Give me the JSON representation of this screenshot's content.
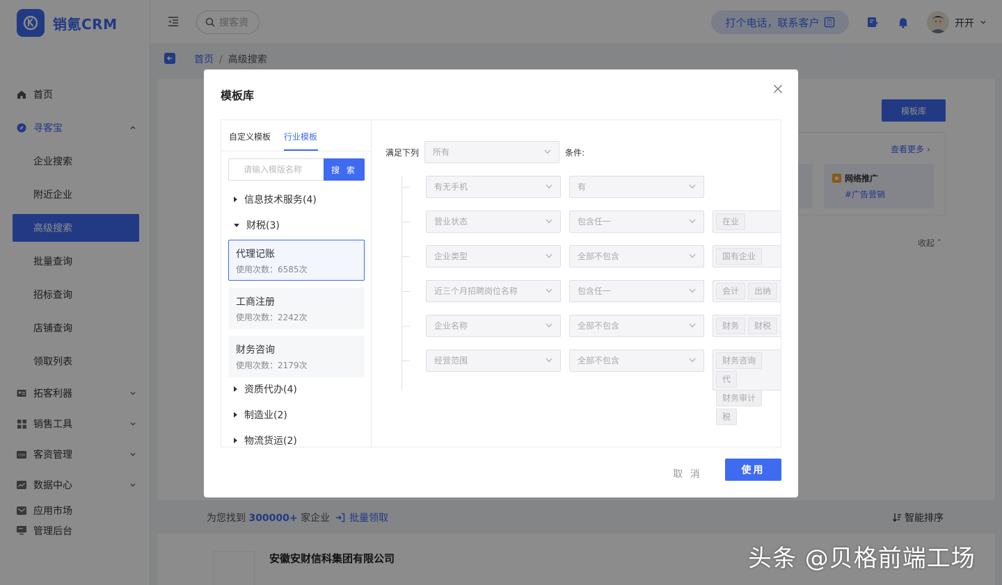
{
  "app": {
    "name": "销氪CRM"
  },
  "header": {
    "search_placeholder": "搜客资",
    "call_button": "打个电话，联系客户",
    "user_name": "开开"
  },
  "sidebar": {
    "items": [
      {
        "label": "首页",
        "icon": "home-icon"
      },
      {
        "label": "寻客宝",
        "icon": "compass-icon",
        "expanded": true
      },
      {
        "label": "拓客利器",
        "icon": "id-card-icon"
      },
      {
        "label": "销售工具",
        "icon": "grid-icon"
      },
      {
        "label": "客资管理",
        "icon": "crm-icon"
      },
      {
        "label": "数据中心",
        "icon": "chart-icon"
      },
      {
        "label": "应用市场",
        "icon": "mail-icon"
      },
      {
        "label": "管理后台",
        "icon": "monitor-icon"
      }
    ],
    "subitems": [
      "企业搜索",
      "附近企业",
      "高级搜索",
      "批量查询",
      "招标查询",
      "店铺查询",
      "领取列表"
    ],
    "active_subitem": "高级搜索"
  },
  "breadcrumb": {
    "home": "首页",
    "current": "高级搜索"
  },
  "page": {
    "template_button": "模板库",
    "see_more": "查看更多",
    "recommend_title": "网络推广",
    "recommend_tag": "#广告营销",
    "collapse": "收起",
    "found_prefix": "为您找到",
    "found_count": "300000+",
    "found_suffix": "家企业",
    "batch_claim": "批量领取",
    "smart_sort": "智能排序",
    "company_name": "安徽安财信科集团有限公司"
  },
  "modal": {
    "title": "模板库",
    "tabs": [
      "自定义模板",
      "行业模板"
    ],
    "active_tab": "行业模板",
    "search_placeholder": "请输入模版名称",
    "search_button": "搜 索",
    "categories_top": [
      {
        "label": "信息技术服务(4)",
        "expanded": false
      },
      {
        "label": "财税(3)",
        "expanded": true
      }
    ],
    "templates": [
      {
        "name": "代理记账",
        "usage": "使用次数：6585次",
        "selected": true
      },
      {
        "name": "工商注册",
        "usage": "使用次数：2242次",
        "selected": false
      },
      {
        "name": "财务咨询",
        "usage": "使用次数：2179次",
        "selected": false
      }
    ],
    "categories_bottom": [
      {
        "label": "资质代办(4)"
      },
      {
        "label": "制造业(2)"
      },
      {
        "label": "物流货运(2)"
      }
    ],
    "match_prefix": "满足下列",
    "match_value": "所有",
    "match_suffix": "条件:",
    "conditions": [
      {
        "field": "有无手机",
        "operator": "有",
        "tags": []
      },
      {
        "field": "营业状态",
        "operator": "包含任一",
        "tags": [
          "在业"
        ]
      },
      {
        "field": "企业类型",
        "operator": "全部不包含",
        "tags": [
          "国有企业"
        ]
      },
      {
        "field": "近三个月招聘岗位名称",
        "operator": "包含任一",
        "tags": [
          "会计",
          "出纳"
        ]
      },
      {
        "field": "企业名称",
        "operator": "全部不包含",
        "tags": [
          "财务",
          "财税"
        ]
      },
      {
        "field": "经营范围",
        "operator": "全部不包含",
        "tags": [
          "财务咨询",
          "代",
          "财务审计",
          "税"
        ]
      }
    ],
    "cancel": "取 消",
    "use": "使用"
  },
  "watermark": "头条 @贝格前端工场",
  "colors": {
    "primary": "#3e6bf0",
    "overlay": "rgba(0,0,0,0.45)"
  }
}
